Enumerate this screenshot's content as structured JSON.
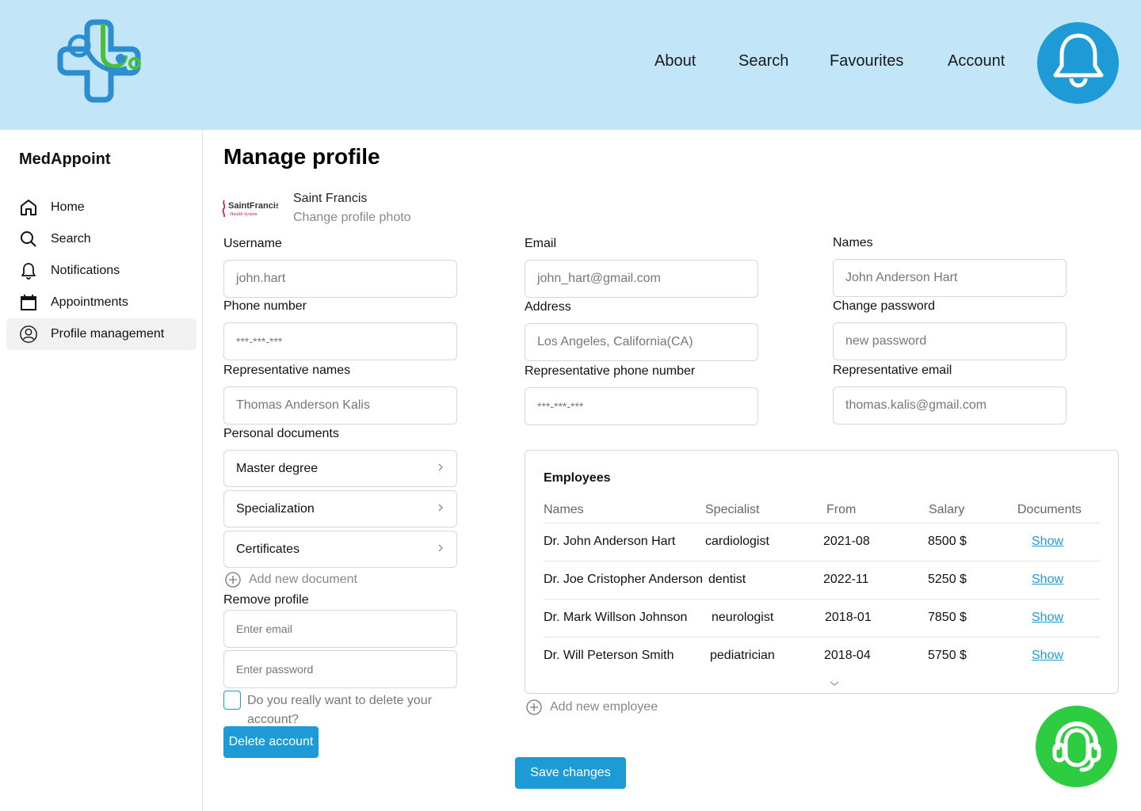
{
  "header": {
    "nav": [
      "About",
      "Search",
      "Favourites",
      "Account"
    ]
  },
  "sidebar": {
    "brand": "MedAppoint",
    "items": [
      {
        "label": "Home",
        "icon": "home-icon"
      },
      {
        "label": "Search",
        "icon": "search-icon"
      },
      {
        "label": "Notifications",
        "icon": "bell-icon"
      },
      {
        "label": "Appointments",
        "icon": "calendar-icon"
      },
      {
        "label": "Profile management",
        "icon": "user-circle-icon",
        "active": true
      }
    ]
  },
  "main": {
    "title": "Manage profile",
    "org": {
      "logo_text": "SaintFrancis",
      "logo_sub": "Health System",
      "name": "Saint Francis",
      "change_photo": "Change profile photo"
    },
    "fields": {
      "username": {
        "label": "Username",
        "value": "john.hart"
      },
      "email": {
        "label": "Email",
        "value": "john_hart@gmail.com"
      },
      "names": {
        "label": "Names",
        "value": "John Anderson Hart"
      },
      "phone": {
        "label": "Phone number",
        "value": "***-***-***"
      },
      "address": {
        "label": "Address",
        "value": "Los Angeles, California(CA)"
      },
      "password": {
        "label": "Change password",
        "placeholder": "new password"
      },
      "rep_names": {
        "label": "Representative names",
        "value": "Thomas Anderson Kalis"
      },
      "rep_phone": {
        "label": "Representative phone number",
        "value": "***-***-***"
      },
      "rep_email": {
        "label": "Representative email",
        "value": "thomas.kalis@gmail.com"
      }
    },
    "documents": {
      "label": "Personal documents",
      "items": [
        "Master degree",
        "Specialization",
        "Certificates"
      ],
      "add": "Add new document"
    },
    "remove": {
      "label": "Remove profile",
      "email_placeholder": "Enter email",
      "password_placeholder": "Enter password",
      "confirm": "Do you really want to delete your account?",
      "button": "Delete account"
    },
    "employees": {
      "title": "Employees",
      "columns": [
        "Names",
        "Specialist",
        "From",
        "Salary",
        "Documents"
      ],
      "rows": [
        {
          "name": "Dr. John Anderson Hart",
          "specialist": "cardiologist",
          "from": "2021-08",
          "salary": "8500 $",
          "doc": "Show"
        },
        {
          "name": "Dr. Joe Cristopher Anderson",
          "specialist": "dentist",
          "from": "2022-11",
          "salary": "5250 $",
          "doc": "Show"
        },
        {
          "name": "Dr. Mark Willson Johnson",
          "specialist": "neurologist",
          "from": "2018-01",
          "salary": "7850 $",
          "doc": "Show"
        },
        {
          "name": "Dr. Will Peterson Smith",
          "specialist": "pediatrician",
          "from": "2018-04",
          "salary": "5750 $",
          "doc": "Show"
        }
      ],
      "add": "Add new employee"
    },
    "save": "Save changes"
  },
  "colors": {
    "header_bg": "#c3e5f8",
    "accent": "#1e9bd7",
    "support": "#2ecc40"
  }
}
